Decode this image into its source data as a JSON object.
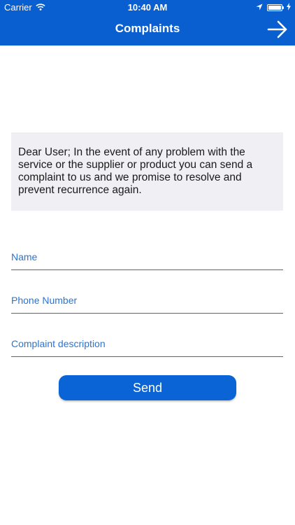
{
  "status_bar": {
    "carrier": "Carrier",
    "time": "10:40 AM",
    "wifi_icon": "wifi-icon",
    "location_icon": "location-arrow-icon",
    "battery_icon": "battery-icon",
    "battery_level": 1.0,
    "charging_icon": "charging-bolt-icon"
  },
  "header": {
    "title": "Complaints",
    "forward_icon": "arrow-right-icon",
    "background_color": "#0a5fd0"
  },
  "info": {
    "text": "Dear User; In the event of any problem with the service or the supplier or product you can send a complaint to us and we promise to resolve and prevent recurrence again."
  },
  "form": {
    "name": {
      "value": "",
      "placeholder": "Name"
    },
    "phone": {
      "value": "",
      "placeholder": "Phone Number"
    },
    "description": {
      "value": "",
      "placeholder": "Complaint description"
    },
    "send_label": "Send",
    "accent_color": "#0a64d6"
  }
}
